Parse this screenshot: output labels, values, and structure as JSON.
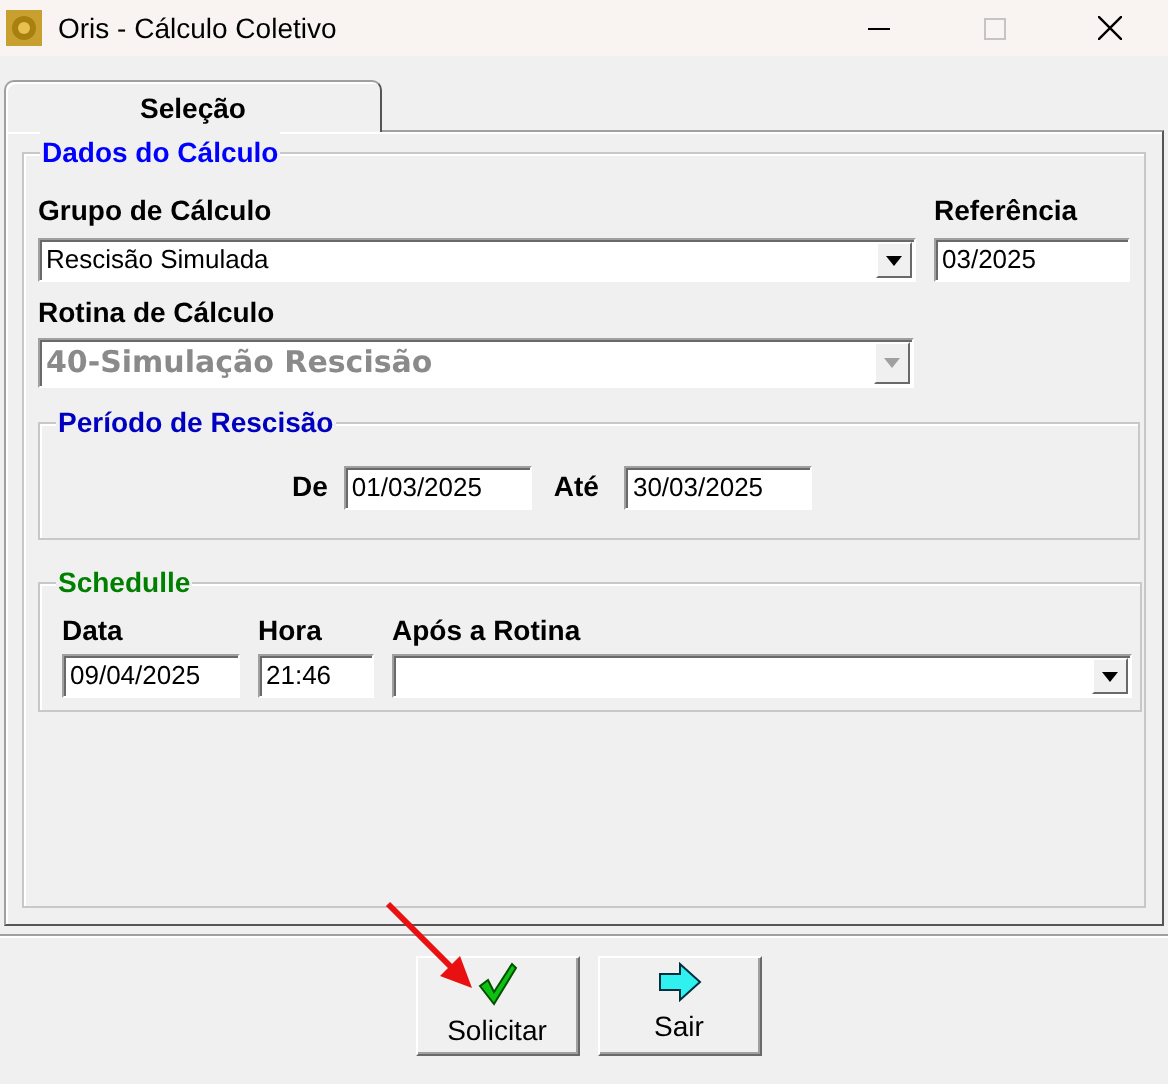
{
  "window": {
    "title": "Oris - Cálculo Coletivo",
    "maximize_disabled": true
  },
  "tabs": [
    {
      "label": "Seleção",
      "selected": true
    }
  ],
  "dados": {
    "legend": "Dados do Cálculo",
    "grupo": {
      "label": "Grupo de Cálculo",
      "value": "Rescisão Simulada"
    },
    "referencia": {
      "label": "Referência",
      "value": "03/2025"
    },
    "rotina": {
      "label": "Rotina de Cálculo",
      "value": "40-Simulação Rescisão",
      "disabled": true
    },
    "periodo": {
      "legend": "Período de Rescisão",
      "de_label": "De",
      "de_value": "01/03/2025",
      "ate_label": "Até",
      "ate_value": "30/03/2025"
    },
    "schedule": {
      "legend": "Schedulle",
      "data_label": "Data",
      "data_value": "09/04/2025",
      "hora_label": "Hora",
      "hora_value": "21:46",
      "apos_label": "Após a Rotina"
    }
  },
  "buttons": [
    {
      "label": "Solicitar",
      "kind": "ok"
    },
    {
      "label": "Sair",
      "kind": "exit"
    }
  ]
}
